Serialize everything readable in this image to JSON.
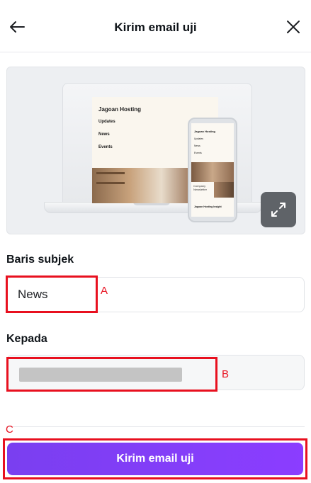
{
  "header": {
    "title": "Kirim email uji",
    "back_icon": "arrow-left-icon",
    "close_icon": "close-icon"
  },
  "preview": {
    "brand": "Jagoan Hosting",
    "nav_items": [
      "Updates",
      "News",
      "Events"
    ],
    "phone_brand": "Jagoan Hosting",
    "phone_nav_items": [
      "Updates",
      "News",
      "Events"
    ],
    "phone_news": "Company Newsletter",
    "phone_insight": "Jagoan Hosting Insight",
    "expand_icon": "expand-icon"
  },
  "subject": {
    "label": "Baris subjek",
    "value": "News"
  },
  "recipient": {
    "label": "Kepada",
    "value_redacted": true
  },
  "submit": {
    "label": "Kirim email uji",
    "color": "#8b3dff"
  },
  "annotations": {
    "a": "A",
    "b": "B",
    "c": "C",
    "color": "#e8101f"
  }
}
